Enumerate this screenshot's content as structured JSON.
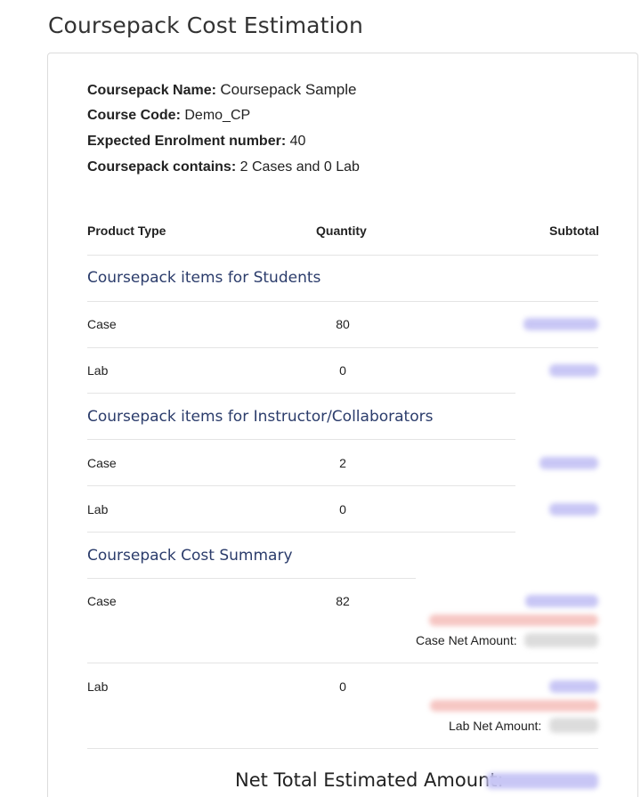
{
  "page_title": "Coursepack Cost Estimation",
  "info": {
    "name_label": "Coursepack Name:",
    "name_value": "Coursepack Sample",
    "code_label": "Course Code:",
    "code_value": "Demo_CP",
    "enrol_label": "Expected Enrolment number:",
    "enrol_value": "40",
    "contains_label": "Coursepack contains:",
    "contains_value": "2 Cases and 0 Lab"
  },
  "table": {
    "headers": {
      "product_type": "Product Type",
      "quantity": "Quantity",
      "subtotal": "Subtotal"
    },
    "students": {
      "title": "Coursepack items for Students",
      "rows": [
        {
          "type": "Case",
          "qty": "80"
        },
        {
          "type": "Lab",
          "qty": "0"
        }
      ]
    },
    "instructors": {
      "title": "Coursepack items for Instructor/Collaborators",
      "rows": [
        {
          "type": "Case",
          "qty": "2"
        },
        {
          "type": "Lab",
          "qty": "0"
        }
      ]
    },
    "summary": {
      "title": "Coursepack Cost Summary",
      "rows": [
        {
          "type": "Case",
          "qty": "82",
          "net_label": "Case Net Amount:"
        },
        {
          "type": "Lab",
          "qty": "0",
          "net_label": "Lab Net Amount:"
        }
      ]
    },
    "net_total_label": "Net Total Estimated Amount:"
  }
}
